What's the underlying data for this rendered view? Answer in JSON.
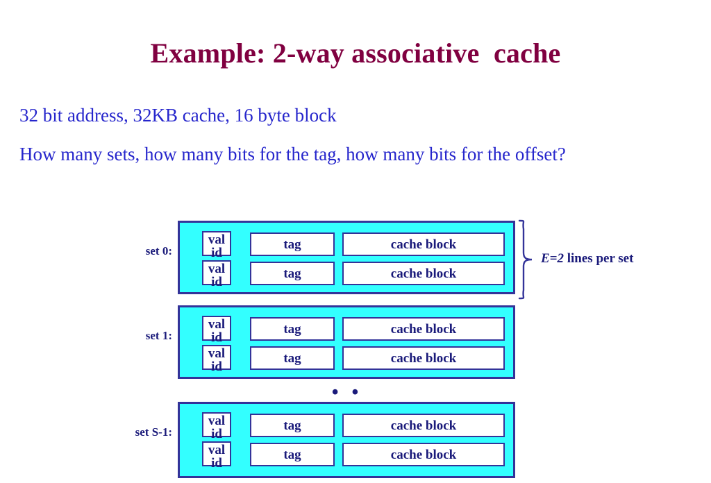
{
  "slide": {
    "title": "Example: 2-way associative  cache",
    "paragraphs": [
      "32 bit address, 32KB cache, 16 byte block",
      "How many sets, how many bits for the tag, how many bits for the offset?"
    ]
  },
  "colors": {
    "title": "#800040",
    "body_text": "#2626CC",
    "diagram_text": "#1A1A7A",
    "set_fill": "#33FFFF",
    "set_border": "#333399",
    "cell_fill": "#FFFFFF",
    "background": "#FFFFFF"
  },
  "diagram": {
    "cell_labels": {
      "valid": "valid",
      "valid_line1": "val",
      "valid_line2": "id",
      "tag": "tag",
      "cache_block": "cache block"
    },
    "ellipsis": "• • •",
    "annotation": {
      "emphasis": "E=2",
      "text": " lines per set"
    },
    "sets": [
      {
        "label": "set 0:",
        "lines": [
          {
            "valid": "valid",
            "tag": "tag",
            "block": "cache block"
          },
          {
            "valid": "valid",
            "tag": "tag",
            "block": "cache block"
          }
        ]
      },
      {
        "label": "set 1:",
        "lines": [
          {
            "valid": "valid",
            "tag": "tag",
            "block": "cache block"
          },
          {
            "valid": "valid",
            "tag": "tag",
            "block": "cache block"
          }
        ]
      },
      {
        "label": "set S-1:",
        "lines": [
          {
            "valid": "valid",
            "tag": "tag",
            "block": "cache block"
          },
          {
            "valid": "valid",
            "tag": "tag",
            "block": "cache block"
          }
        ]
      }
    ]
  }
}
